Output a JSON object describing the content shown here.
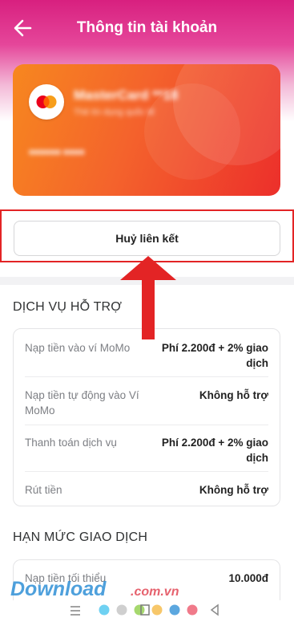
{
  "header": {
    "title": "Thông tin tài khoản"
  },
  "card": {
    "brand_icon": "mastercard-logo",
    "name": "MasterCard **18",
    "line1": "Thẻ tín dụng quốc tế",
    "line2": "■■■■■■ ■■■■"
  },
  "actions": {
    "unlink_label": "Huỷ liên kết"
  },
  "support": {
    "title": "DỊCH VỤ HỖ TRỢ",
    "rows": [
      {
        "label": "Nạp tiền vào ví MoMo",
        "value": "Phí 2.200đ + 2% giao dịch"
      },
      {
        "label": "Nạp tiền tự động vào Ví MoMo",
        "value": "Không hỗ trợ"
      },
      {
        "label": "Thanh toán dịch vụ",
        "value": "Phí 2.200đ + 2% giao dịch"
      },
      {
        "label": "Rút tiền",
        "value": "Không hỗ trợ"
      }
    ]
  },
  "limits": {
    "title": "HẠN MỨC GIAO DỊCH",
    "rows": [
      {
        "label": "Nạp tiền tối thiểu",
        "value": "10.000đ"
      }
    ]
  },
  "watermark": {
    "text": "Download",
    "suffix": ".com.vn"
  },
  "colors": {
    "header": "#d8207f",
    "annotation_red": "#e32425",
    "card_start": "#f7871f",
    "card_end": "#ec2f2b"
  }
}
